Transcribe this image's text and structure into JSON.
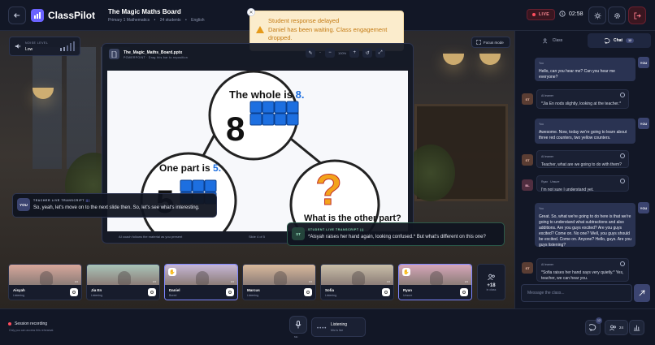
{
  "header": {
    "app_name": "ClassPilot",
    "lesson_title": "The Magic Maths Board",
    "class_name": "Primary 1 Mathematics",
    "student_count": "24 students",
    "subject": "English",
    "live_label": "LIVE",
    "timer": "02:58"
  },
  "toast": {
    "title": "Student response delayed",
    "body": "Daniel has been waiting. Class engagement dropped."
  },
  "noise": {
    "label": "NOISE LEVEL",
    "value": "Low",
    "bars": [
      0.3,
      0.45,
      0.6,
      0.8,
      1.0
    ]
  },
  "focus_mode_label": "Focus mode",
  "presentation": {
    "file_name": "The_Magic_Maths_Board.pptx",
    "file_subtitle": "POWERPOINT · Drag this bar to reposition",
    "zoom": "100%",
    "footer_note": "AI coach follows the material as you present",
    "slide_counter": "Slide 4 of 5",
    "slide": {
      "whole_text": "The whole is ",
      "whole_value": "8.",
      "whole_number": "8",
      "part_text": "One part is ",
      "part_value": "5.",
      "part_number": "5",
      "question_mark": "?",
      "other_text": "What is the other part?"
    }
  },
  "teacher_transcript": {
    "avatar": "YOU",
    "label": "TEACHER LIVE TRANSCRIPT",
    "text": "So, yeah, let's move on to the next slide then. So, let's see what's interesting."
  },
  "student_transcript": {
    "avatar": "ST",
    "label": "STUDENT LIVE TRANSCRIPT",
    "text": "*Aisyah raises her hand again, looking confused.* But what's different on this one?"
  },
  "participants": [
    {
      "name": "Aisyah",
      "status": "Listening",
      "tag": "4/4",
      "raised": false,
      "color": "#d8a79b"
    },
    {
      "name": "Jia En",
      "status": "Listening",
      "tag": "4/4",
      "raised": false,
      "color": "#a9c4b8"
    },
    {
      "name": "Daniel",
      "status": "Bored",
      "tag": "3/4",
      "raised": true,
      "color": "#c6b6d6"
    },
    {
      "name": "Marcus",
      "status": "Listening",
      "tag": "4/4",
      "raised": false,
      "color": "#d9b99c"
    },
    {
      "name": "Sofia",
      "status": "Listening",
      "tag": "4/4",
      "raised": false,
      "color": "#c9bfa8"
    },
    {
      "name": "Ryan",
      "status": "Unsure",
      "tag": "2/4",
      "raised": true,
      "color": "#d6a6b9"
    }
  ],
  "more_participants": {
    "count": "+18",
    "label": "in class"
  },
  "bottom": {
    "session_recording": "Session recording",
    "recording_note": "Only you can access this rehearsal.",
    "mic_label": "Mic",
    "listening": "Listening",
    "listening_sub": "Mic is live",
    "badge_chat": "12",
    "people_count": "24"
  },
  "chat": {
    "tab_class": "Class",
    "tab_chat": "Chat",
    "tab_chat_badge": "12",
    "messages": [
      {
        "who": "You",
        "avatar": "YOU",
        "text": "Hello, can you hear me? Can you hear me everyone?"
      },
      {
        "who": "AI learner",
        "avatar": "ST",
        "text": "*Jia En nods slightly, looking at the teacher.*"
      },
      {
        "who": "You",
        "avatar": "YOU",
        "text": "Awesome. Now, today we're going to learn about three red counters, two yellow counters."
      },
      {
        "who": "AI learner",
        "avatar": "ST",
        "text": "Teacher, what are we going to do with them?"
      },
      {
        "who": "Ryan",
        "avatar": "BL",
        "extra": "Unsure",
        "text": "I'm not sure I understand yet."
      },
      {
        "who": "You",
        "avatar": "YOU",
        "text": "Great. So, what we're going to do here is that we're going to understand what subtractions and also additions. Are you guys excited? Are you guys excited? Come on. No one? Well, you guys should be excited. Come on. Anyone? Hello, guys. Are you guys listening?"
      },
      {
        "who": "AI learner",
        "avatar": "ST",
        "text": "*Sofia raises her hand says very quietly.* Yes, teacher, we can hear you."
      }
    ],
    "input_placeholder": "Message the class..."
  },
  "colors": {
    "accent": "#6b63ff",
    "toast_bg": "#fbeccc",
    "toast_text": "#c47a12",
    "cube_blue": "#1d6fe0",
    "live_red": "#ff4d5e"
  }
}
